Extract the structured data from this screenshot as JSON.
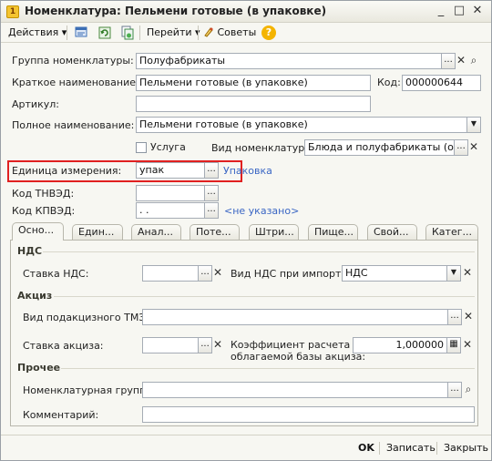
{
  "window": {
    "title": "Номенклатура: Пельмени готовые (в упаковке)",
    "minimize_glyph": "_",
    "maximize_glyph": "□",
    "close_glyph": "✕"
  },
  "toolbar": {
    "actions_label": "Действия",
    "goto_label": "Перейти",
    "tips_label": "Советы",
    "dropdown_glyph": "▾",
    "help_glyph": "?"
  },
  "form": {
    "group": {
      "label": "Группа номенклатуры:",
      "value": "Полуфабрикаты"
    },
    "short_name": {
      "label": "Краткое наименование:",
      "value": "Пельмени готовые (в упаковке)"
    },
    "code": {
      "label": "Код:",
      "value": "000000644"
    },
    "article": {
      "label": "Артикул:",
      "value": ""
    },
    "full_name": {
      "label": "Полное наименование:",
      "value": "Пельмени готовые (в упаковке)"
    },
    "service": {
      "label": "Услуга",
      "checked": false
    },
    "kind": {
      "label": "Вид номенклатуры:",
      "value": "Блюда и полуфабрикаты (общее"
    },
    "unit": {
      "label": "Единица измерения:",
      "value": "упак",
      "link": "Упаковка"
    },
    "tnved": {
      "label": "Код ТНВЭД:",
      "value": ""
    },
    "kpved": {
      "label": "Код КПВЭД:",
      "value": ". .",
      "link": "<не указано>"
    }
  },
  "buttons": {
    "select_glyph": "...",
    "clear_glyph": "✕",
    "search_glyph": "⌕",
    "dropdown_glyph": "▼",
    "calc_glyph": "▦"
  },
  "tabs": [
    "Осно...",
    "Един...",
    "Анал...",
    "Поте...",
    "Штри...",
    "Пище...",
    "Свой...",
    "Катег..."
  ],
  "panel": {
    "vat": {
      "section": "НДС",
      "rate_label": "Ставка НДС:",
      "rate_value": "",
      "import_label": "Вид НДС при импорте:",
      "import_value": "НДС"
    },
    "excise": {
      "section": "Акциз",
      "kind_label": "Вид подакцизного ТМЗ:",
      "kind_value": "",
      "rate_label": "Ставка акциза:",
      "rate_value": "",
      "coef_label_1": "Коэффициент расчета",
      "coef_label_2": "облагаемой базы акциза:",
      "coef_value": "1,000000"
    },
    "other": {
      "section": "Прочее",
      "group_label": "Номенклатурная группа:",
      "group_value": "",
      "comment_label": "Комментарий:",
      "comment_value": ""
    }
  },
  "footer": {
    "ok_label": "OK",
    "save_label": "Записать",
    "close_label": "Закрыть"
  }
}
